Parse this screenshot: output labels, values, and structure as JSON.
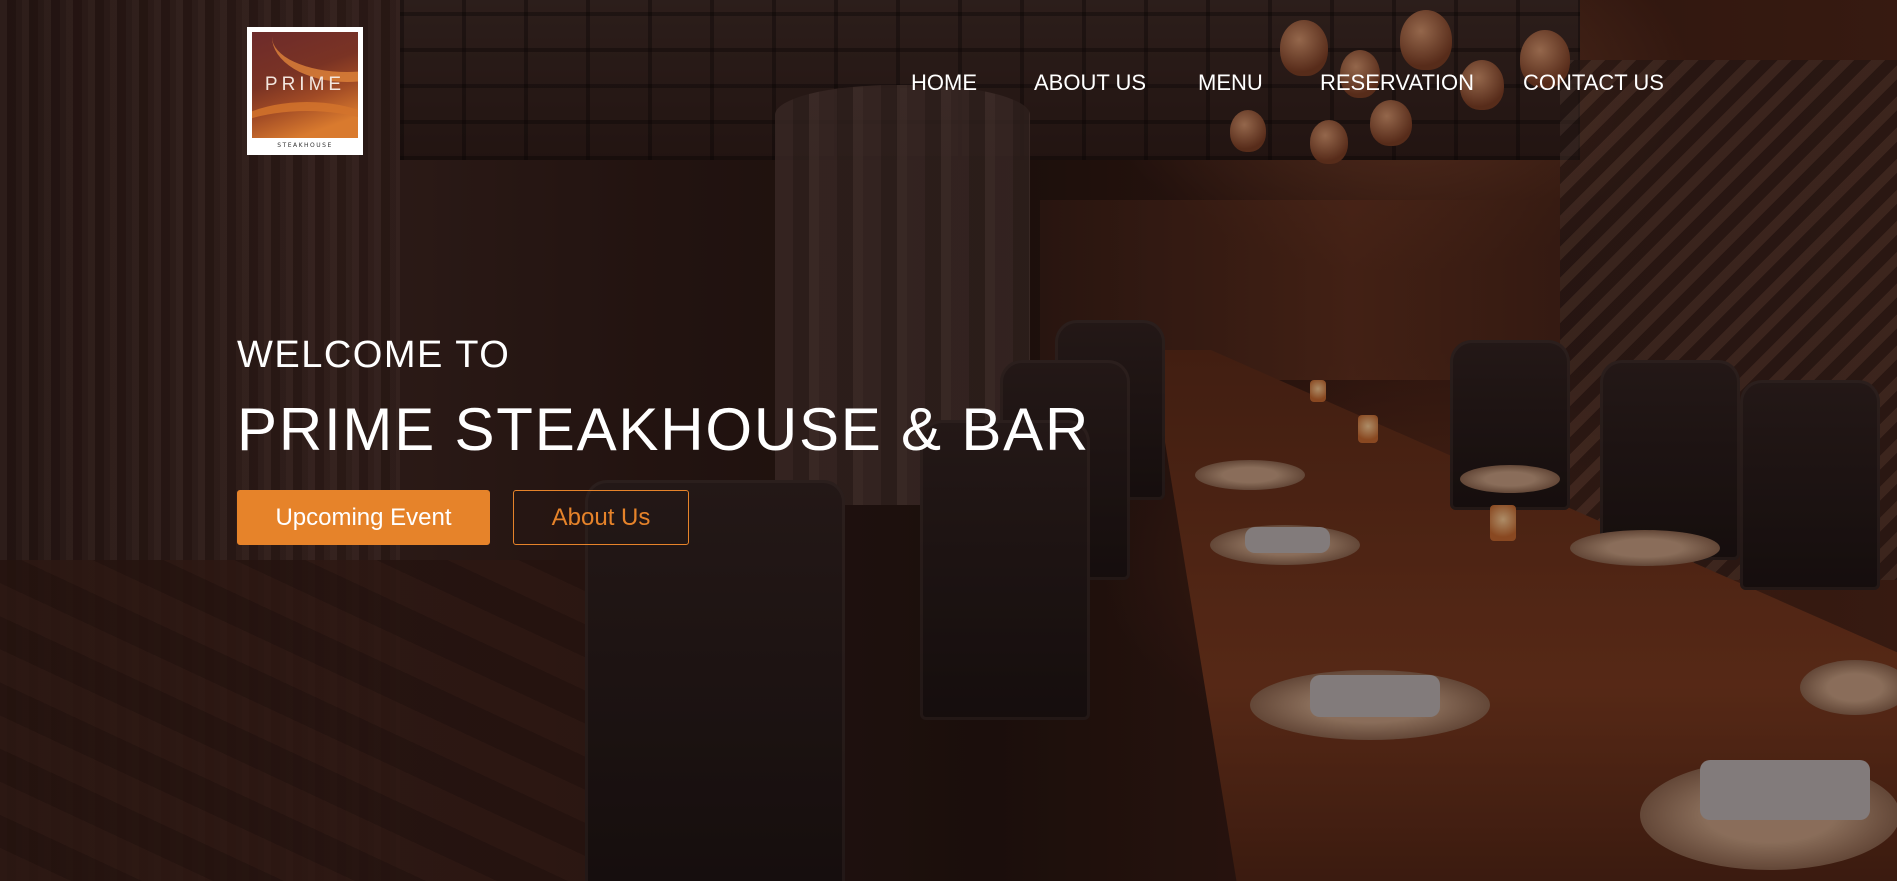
{
  "logo": {
    "name": "PRIME",
    "tagline": "STEAKHOUSE"
  },
  "nav": {
    "items": [
      {
        "label": "HOME"
      },
      {
        "label": "ABOUT US"
      },
      {
        "label": "MENU"
      },
      {
        "label": "RESERVATION"
      },
      {
        "label": "CONTACT US"
      }
    ]
  },
  "hero": {
    "welcome": "WELCOME TO",
    "title": "PRIME STEAKHOUSE & BAR",
    "primary_button": "Upcoming Event",
    "secondary_button": "About Us"
  },
  "colors": {
    "accent": "#e6832a",
    "text": "#ffffff",
    "logo_bg": "#ffffff"
  },
  "icons": {
    "logo": "prime-steakhouse-logo"
  }
}
